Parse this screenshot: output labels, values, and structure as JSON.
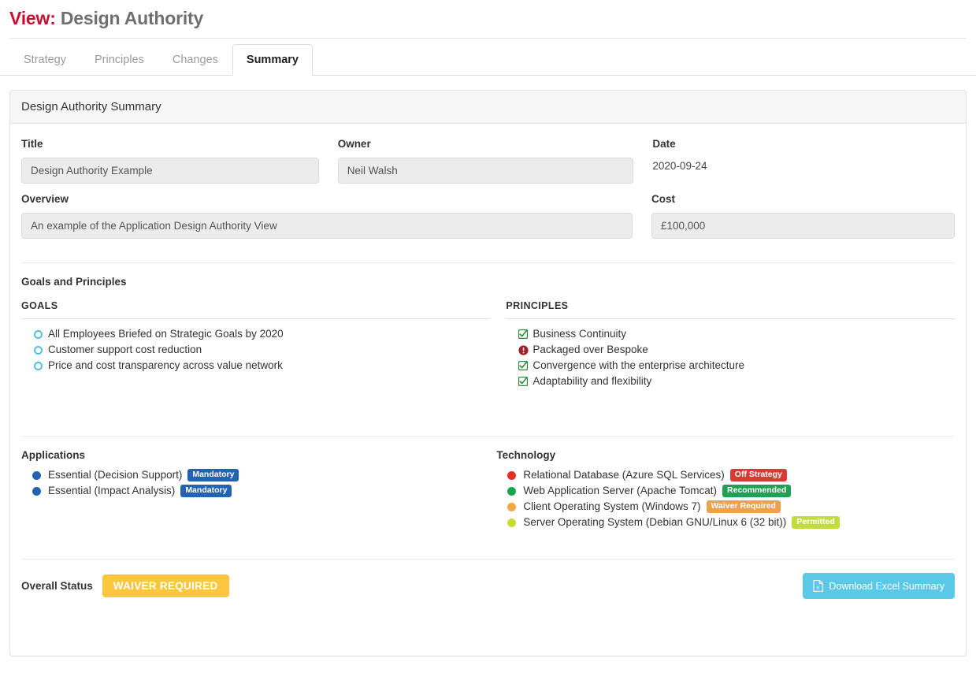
{
  "header": {
    "title_prefix": "View:",
    "title_main": "Design Authority"
  },
  "tabs": [
    {
      "label": "Strategy",
      "active": false
    },
    {
      "label": "Principles",
      "active": false
    },
    {
      "label": "Changes",
      "active": false
    },
    {
      "label": "Summary",
      "active": true
    }
  ],
  "card": {
    "header_title": "Design Authority Summary"
  },
  "fields": {
    "title_label": "Title",
    "title_value": "Design Authority Example",
    "owner_label": "Owner",
    "owner_value": "Neil Walsh",
    "date_label": "Date",
    "date_value": "2020-09-24",
    "overview_label": "Overview",
    "overview_value": "An example of the Application Design Authority View",
    "cost_label": "Cost",
    "cost_value": "£100,000"
  },
  "goals_principles": {
    "section_title": "Goals and Principles",
    "goals_heading": "GOALS",
    "principles_heading": "PRINCIPLES",
    "goals": [
      {
        "text": "All Employees Briefed on Strategic Goals by 2020",
        "icon": "circle-outline-icon"
      },
      {
        "text": "Customer support cost reduction",
        "icon": "circle-outline-icon"
      },
      {
        "text": "Price and cost transparency across value network",
        "icon": "circle-outline-icon"
      }
    ],
    "principles": [
      {
        "text": "Business Continuity",
        "icon": "check-square-icon"
      },
      {
        "text": "Packaged over Bespoke",
        "icon": "exclamation-circle-icon"
      },
      {
        "text": "Convergence with the enterprise architecture",
        "icon": "check-square-icon"
      },
      {
        "text": "Adaptability and flexibility",
        "icon": "check-square-icon"
      }
    ]
  },
  "applications": {
    "title": "Applications",
    "items": [
      {
        "text": "Essential (Decision Support)",
        "badge": "Mandatory",
        "badge_color": "#2263b3",
        "dot_color": "#2263b3"
      },
      {
        "text": "Essential (Impact Analysis)",
        "badge": "Mandatory",
        "badge_color": "#2263b3",
        "dot_color": "#2263b3"
      }
    ]
  },
  "technology": {
    "title": "Technology",
    "items": [
      {
        "text": "Relational Database (Azure SQL Services)",
        "badge": "Off Strategy",
        "badge_color": "#d93a33",
        "dot_color": "#e03127"
      },
      {
        "text": "Web Application Server (Apache Tomcat)",
        "badge": "Recommended",
        "badge_color": "#1fa053",
        "dot_color": "#17a44c"
      },
      {
        "text": "Client Operating System (Windows 7)",
        "badge": "Waiver Required",
        "badge_color": "#f0a04b",
        "dot_color": "#f5a63f"
      },
      {
        "text": "Server Operating System (Debian GNU/Linux 6 (32 bit))",
        "badge": "Permitted",
        "badge_color": "#c2dc3e",
        "dot_color": "#cadb37"
      }
    ]
  },
  "footer": {
    "status_label": "Overall Status",
    "status_value": "WAIVER REQUIRED",
    "status_color": "#fcc63f",
    "download_label": "Download Excel Summary",
    "download_icon": "excel-file-icon",
    "download_color": "#5bc8e8"
  },
  "colors": {
    "accent_red": "#c8102e",
    "goal_icon": "#55bfe0",
    "principle_ok": "#2e8b3d",
    "principle_warn": "#a02128"
  }
}
